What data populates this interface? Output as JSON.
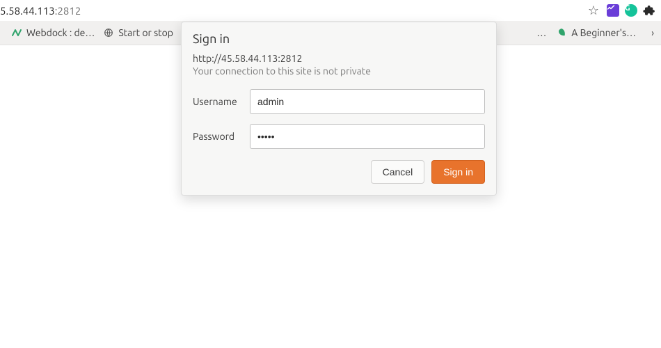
{
  "omnibox": {
    "host_fragment": "5.58.44.113",
    "port_fragment": ":2812"
  },
  "toolbar": {
    "star_title": "Bookmark this page",
    "ext_purple_label": "~",
    "ext_green_label": "G",
    "ext_puzzle_title": "Extensions"
  },
  "bookmarks": {
    "items": [
      {
        "label": "Webdock : de…"
      },
      {
        "label": "Start or stop"
      }
    ],
    "ellipsis_middle": "…",
    "right_item": {
      "label": "A Beginner's…"
    },
    "overflow_title": "More bookmarks"
  },
  "dialog": {
    "title": "Sign in",
    "url_line": "http://45.58.44.113:2812",
    "warning": "Your connection to this site is not private",
    "username_label": "Username",
    "password_label": "Password",
    "username_value": "admin",
    "password_value": "•••••",
    "cancel_label": "Cancel",
    "signin_label": "Sign in"
  }
}
